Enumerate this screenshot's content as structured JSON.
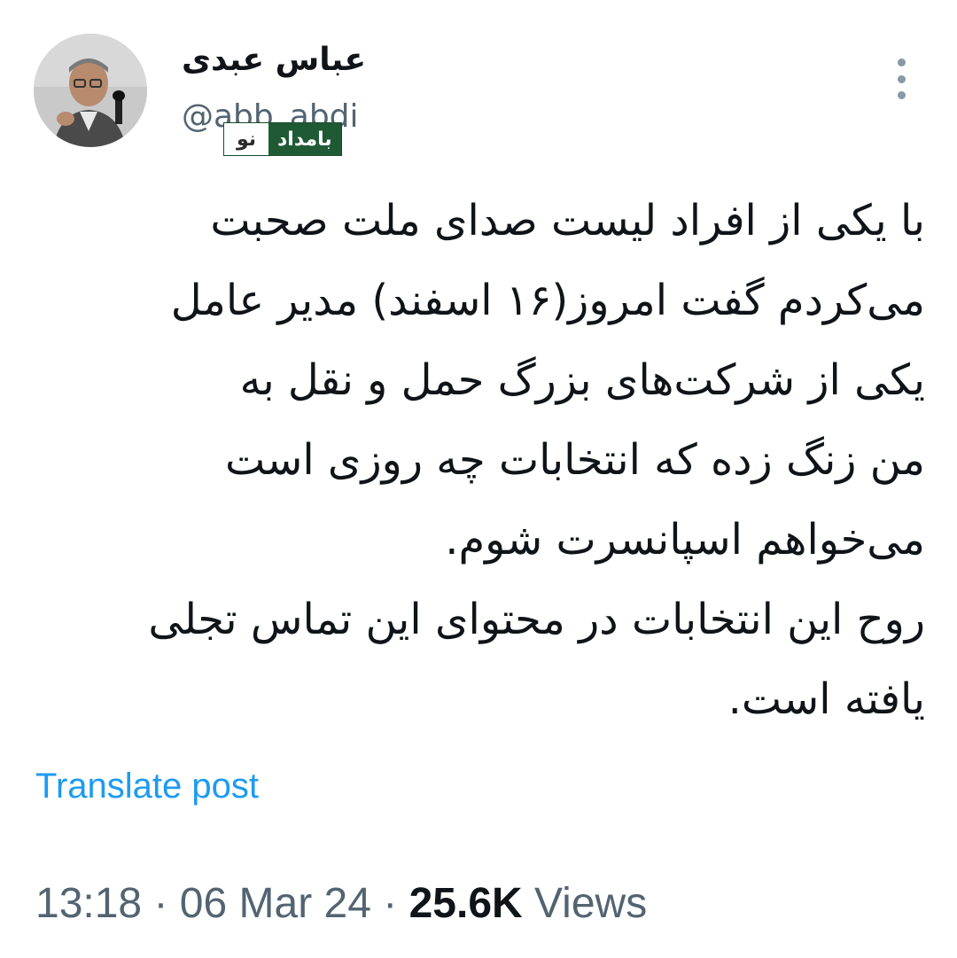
{
  "author": {
    "display_name": "عباس عبدی",
    "handle": "@abb_abdi"
  },
  "watermark": {
    "big": "بامداد",
    "small": "نو"
  },
  "tweet": {
    "lines": [
      "با یکی از افراد لیست صدای ملت صحبت",
      "می‌کردم گفت امروز(۱۶ اسفند) مدیر عامل",
      "یکی از شرکت‌های بزرگ حمل و نقل به",
      "من زنگ زده که انتخابات چه روزی است",
      "می‌خواهم اسپانسرت شوم.",
      "روح این انتخابات در محتوای این تماس تجلی",
      "یافته است."
    ]
  },
  "translate_label": "Translate post",
  "meta": {
    "time": "13:18",
    "separator": "·",
    "date": "06 Mar 24",
    "views_count": "25.6K",
    "views_label": "Views"
  },
  "icons": {
    "more": "more-options-icon",
    "avatar": "profile-avatar"
  }
}
